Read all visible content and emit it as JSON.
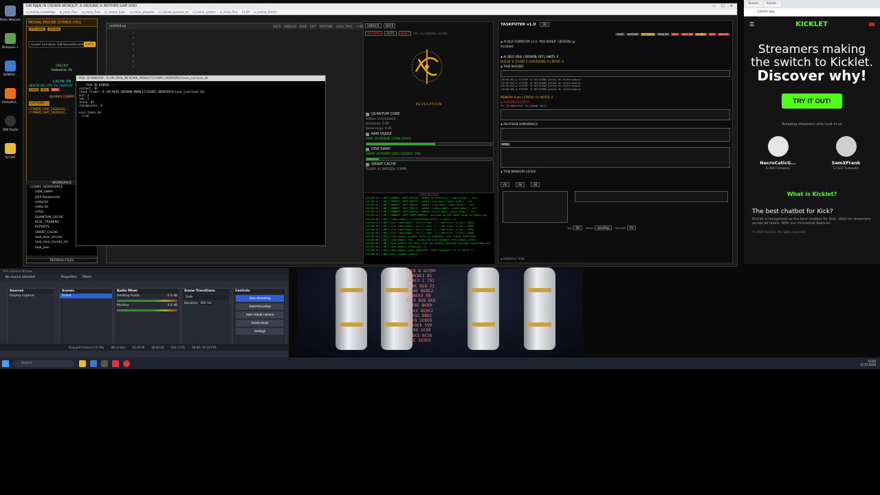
{
  "desktop": {
    "icons": [
      "Music Webcam",
      "Notepad++",
      "DUMPER...",
      "FirefoxPort...",
      "OBS Studio",
      "Fy-Cam"
    ]
  },
  "mainwin": {
    "title": "UM MAIN IN CROWN MONOLIT: A GROUND & MOTHER SAM VOID",
    "tabs": [
      "ui_mainw_knowledge",
      "ui_main_flow",
      "ui_menu_flow",
      "ui_mainw_tools",
      "ui_menu_playable",
      "ui_mainw_spectral_ok",
      "ui_menu_system",
      "ui_main_flow",
      "UI_ER",
      "ui_mainw_theme"
    ],
    "controls": [
      "—",
      "□",
      "✕"
    ]
  },
  "neural": {
    "title": "NEURAL ENGINE [STABLE-CPU]",
    "gtx": "GTX 4096",
    "cpu": "CPU 8%",
    "ignite": "IGNITE",
    "model": "Goedel-Formalizer-32B-SonnetAnnotated",
    "online": "ONLINE",
    "loading": "Ładowanie: 1%",
    "cache_title": "CACHE ON",
    "cache_line": "HEALTH OK | CPU 3% | RAM EXT",
    "safe": "SAFE",
    "bal": "BAL",
    "max": "MAX",
    "quarks": "QUARKS [SNIPP]",
    "capture": "CAPTURE",
    "ctx1": "CTXMEM_CHAT_20260310_...",
    "ctx2": "CTXMEM_CHAT_20260310_...",
    "workspace_title": "WORKSPACE",
    "tree": [
      "COSMIC_WORKSPACE",
      "DISK_SWAP",
      "Dtill-Kwazonator",
      "editor2d",
      "editor3d",
      "mllzg",
      "QUANTUM_CACHE",
      "REAL_TRAINING",
      "REPORTS",
      "SMART_CACHE",
      "task_dual_chunks",
      "task_dual_chunks_3d",
      "task_json"
    ],
    "refresh": "REFRESH FILES"
  },
  "editor": {
    "file": "untitled.py",
    "menu": [
      "DOCS",
      "UNDOCK",
      "SAVE",
      "EXIT",
      "RESTORE",
      "LOAD_TOOL",
      "+ INTEGR..."
    ],
    "lines": [
      "1",
      "2",
      "3",
      "4",
      "5",
      "6",
      "7"
    ]
  },
  "taskwin": {
    "title": "TASK 3D WINDOW - D:\\3M_MAIN_INCROWN_MONOLIT\\COSMIC_WORKSPACE\\task_json\\task_3d",
    "body": "--- TASK 3D WINDOW ---\ncontent: 3D\n[task folder: D:\\3M_MAIN_INCROWN_MONOLIT\\COSMIC_WORKSPACE\\task_json\\task_3d]\nout: 3\nidx: 1\nthink: 03\ncheckpoints: 0\n\nuser_tasks_3d:\n- true"
  },
  "quantum": {
    "buttons": [
      "UNDOCK",
      "DOCK"
    ],
    "actions": [
      "AKTYWNY",
      "AUTO",
      "RESET"
    ],
    "meta": "FPS: 10 | RENDER: CACHED",
    "revelation": "REVELATION",
    "core_title": "QUANTUM CORE",
    "status": "Status: Inicjalizacja...",
    "solatanie": "Solatanie: 0.00",
    "koherencja": "Koherencja: 0.00",
    "ram_title": "RAM USAGE",
    "ram_state": "RAM: OCZEKUJE (STAN ZERO)",
    "ram_fill": 0.55,
    "disk_title": "DISK SWAP",
    "swap_state": "SWAP: GOTOWY (SOLI EGGIO): 10%",
    "swap_fill": 0.1,
    "smart_title": "SMART CACHE",
    "smart_state": "ŚLADY: 4 | WIEDZA: 0.0MB",
    "logs_title": "SYSTEM LOGS",
    "logs": [
      "[20:00:41] [INF] CONNECT_INIT_RESULT: added (StaticFunc): logit bias = -inf",
      "[20:00:41] [INF] CONNECT_INIT_RESULT: added <|im_end|> logit bias = -inf",
      "[20:00:41] [INF] CONNECT_INIT_RESULT: added <|fim_pad|> logit bias = -inf",
      "[20:00:41] [INF] CONNECT_INIT_RESULT: added <|repo_name|> logit bias = -inf",
      "[20:00:41] [INF] CONNECT_INIT_RESULT: added <|file_sep|> logit bias = -inf",
      "[20:00:41] [INF] CONNECT_INIT_FROM_GENERAL: setting up the model with an empty run",
      "[20:00:50] [INF] llama_model: initializing slots, n_slots = 4",
      "[20:00:50] [INF] slot load_model: id 0 | task -1 | new slot, n_ctx = 4096",
      "[20:00:50] [INF] slot load_model: id 1 | task -1 | new slot, n_ctx = 4096",
      "[20:00:50] [INF] slot load_model: id 2 | task -1 | new slot, n_ctx = 4096",
      "[20:00:50] [INF] slot load_model: id 3 | task -1 | new slot, n_ctx = 4096",
      "[20:00:50] [INF] load_model: prompt cache is enabled, size limit: 8192 MiB",
      "[20:00:50] [INF] load_model: use --cache-ram 0 to disable the prompt cache",
      "[20:00:50] [INF] load_model: for more info see https://github.com/ggml-org/llama.cpp",
      "[20:00:50] [INF] load_model: thinking = 0",
      "[20:00:50] [INF] load_model: chat template, chat_template: {% if tools %}",
      "[20:00:50] [INF] main: model loaded"
    ]
  },
  "taskputer": {
    "title": "TASKPUTER v1.0",
    "mode": "3D",
    "tabs": [
      "CHAT",
      "HISTORY",
      "SETTINGS",
      "TASK 3D",
      "SELF",
      "SELF ON",
      "AI SELF",
      "PIPE",
      "DIALOG"
    ],
    "line1": "◈ AI SELF-COMPUTER v1.0 · PRO KODER · SESSION: @",
    "line2": "Architekt:",
    "line3": "◈ AI_SELF: IDLE | SESSION: OFF | HINTS: 0",
    "line4": "QUEUE: 0 | FLOW: 0 | DECISIONS: 0 | RETRY: 0",
    "task_builder": "◈ TASK BUILDER",
    "logs": [
      "[20:00:40] ▶ SYSTEM: AI DECISIONS gotowy do rejestrowania",
      "[20:00:40] ▶ SYSTEM: AI DECISIONS gotowy do rejestrowania",
      "[20:00:40] ▶ SYSTEM: AI DECISIONS gotowy do rejestrowania",
      "[20:00:40] ▶ SYSTEM: AI DECISIONS gotowy do rejestrowania"
    ],
    "memory": "MEMORY: 0 pts | STATUS: 0 | NOTES: 0",
    "deps": "◈ ZALEZNOSCI DO AI",
    "ai_msg": "AI: Ta odpowiedz nie wymaga akcji",
    "hint": "◈ PROTOKÓŁ KOMUNIKACJI",
    "send": "SEND",
    "task_manager": "◈ TASK MANAGER 20/500",
    "field1": "All",
    "field2": "All",
    "field3": "All",
    "type_label": "Typ:",
    "type_val": "3D",
    "status_label": "Status:",
    "status_val": "pending",
    "prio_label": "Priorytet:",
    "prio_val": "P3",
    "footer": "◈ KONSOLA TASK"
  },
  "browser": {
    "tab1": "Stream...",
    "tab2": "Kicklet...",
    "url": "kicklet.app",
    "logo": "KICKLET",
    "hero1": "Streamers making",
    "hero2": "the switch to Kicklet.",
    "hero3": "Discover why!",
    "cta": "TRY IT OUT!",
    "trust": "Amazing streamers who trust in us",
    "streamers": [
      {
        "name": "NecroCaticG...",
        "followers": "6,008 Followers"
      },
      {
        "name": "SamXFrank",
        "followers": "17,032 Followers"
      }
    ],
    "what": "What is Kicklet?",
    "best": "The best chatbot for Kick?",
    "desc": "Kicklet is recognized as the best chatbot for Kick, ideal for streamers across all levels. With our innovative features",
    "copyright": "© 2025 Kicklet. All rights reserved."
  },
  "obs": {
    "status": "50%    Scale to Window",
    "no_source": "No source selected",
    "properties": "Properties",
    "filters": "Filters",
    "sources_title": "Sources",
    "source_item": "Display Capture",
    "scenes_title": "Scenes",
    "scene_item": "Scene",
    "mixer_title": "Audio Mixer",
    "desktop_audio": "Desktop Audio",
    "mic_aux": "Mic/Aux",
    "db1": "0.0 dB",
    "db2": "0.0 dB",
    "transitions_title": "Scene Transitions",
    "fade": "Fade",
    "duration_label": "Duration",
    "duration_val": "300 ms",
    "controls_title": "Controls",
    "stop_stream": "Stop Streaming",
    "start_record": "Start Recording",
    "virtual_cam": "Start Virtual Camera",
    "studio": "Studio Mode",
    "settings": "Settings",
    "dropped": "Dropped Frames 0 (0.0%)",
    "kbps": "861.8 kb/s",
    "time1": "00:20:09",
    "time2": "00:00:00",
    "cpu": "CPU: 0.3%",
    "fps": "60.00 / 60.00 FPS"
  },
  "armor": {
    "numbers": [
      "€8€8 8 82399",
      "80€8€3 85",
      "8€8€3 1 793",
      "€€8€ 8€8 23",
      "3€8€ 8€8€2",
      "88€€9 99",
      "22 8 8€8 8€8",
      "€€8€ 8€89",
      "88€€ 8€8€2",
      "8€82 88€€",
      "€€8 2€8€8",
      "€€8€8 599",
      "288 €€89",
      "€8€8 8€58",
      "8€ 5€9€9"
    ]
  },
  "taskbar": {
    "search": "Search",
    "time": "20:04",
    "date": "12.03.2026"
  }
}
